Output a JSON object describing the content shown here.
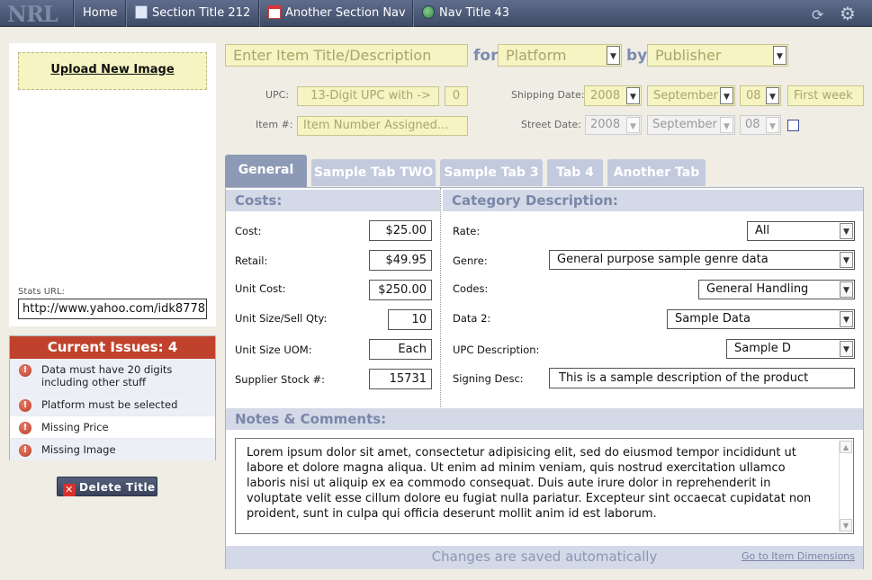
{
  "nav": {
    "logo": "NRL",
    "items": [
      {
        "label": "Home",
        "icon": "none"
      },
      {
        "label": "Section Title 212",
        "icon": "document-icon"
      },
      {
        "label": "Another Section Nav",
        "icon": "calendar-icon"
      },
      {
        "label": "Nav Title 43",
        "icon": "globe-icon"
      }
    ],
    "right_icons": [
      "refresh-icon",
      "gear-icon"
    ]
  },
  "left": {
    "upload_label": "Upload New Image",
    "stats_label": "Stats URL:",
    "stats_url": "http://www.yahoo.com/idk8778",
    "issues_title": "Current Issues: 4",
    "issues": [
      "Data must have 20 digits including other stuff",
      "Platform must be selected",
      "Missing Price",
      "Missing Image"
    ],
    "delete_label": "Delete Title"
  },
  "header": {
    "title_placeholder": "Enter Item Title/Description",
    "for_label": "for",
    "platform": "Platform",
    "by_label": "by",
    "publisher": "Publisher",
    "upc_label": "UPC:",
    "upc_placeholder": "13-Digit UPC with ->",
    "upc_check": "0",
    "item_label": "Item #:",
    "item_placeholder": "Item Number Assigned...",
    "shipping_label": "Shipping Date:",
    "ship_year": "2008",
    "ship_month": "September",
    "ship_day": "08",
    "ship_week": "First week",
    "street_label": "Street Date:",
    "street_year": "2008",
    "street_month": "September",
    "street_day": "08"
  },
  "tabs": [
    "General",
    "Sample Tab TWO",
    "Sample Tab 3",
    "Tab 4",
    "Another Tab"
  ],
  "costs": {
    "title": "Costs:",
    "rows": [
      {
        "label": "Cost:",
        "value": "$25.00"
      },
      {
        "label": "Retail:",
        "value": "$49.95"
      },
      {
        "label": "Unit Cost:",
        "value": "$250.00"
      },
      {
        "label": "Unit Size/Sell Qty:",
        "value": "10"
      },
      {
        "label": "Unit Size UOM:",
        "value": "Each"
      },
      {
        "label": "Supplier Stock #:",
        "value": "15731"
      }
    ]
  },
  "category": {
    "title": "Category Description:",
    "rows": [
      {
        "label": "Rate:",
        "value": "All"
      },
      {
        "label": "Genre:",
        "value": "General purpose sample genre data"
      },
      {
        "label": "Codes:",
        "value": "General Handling"
      },
      {
        "label": "Data 2:",
        "value": "Sample Data"
      },
      {
        "label": "UPC Description:",
        "value": "Sample D"
      },
      {
        "label": "Signing Desc:",
        "value": "This is a sample description of the product"
      }
    ]
  },
  "notes": {
    "title": "Notes & Comments:",
    "text": "Lorem ipsum dolor sit amet, consectetur adipisicing elit, sed do eiusmod tempor incididunt ut labore et dolore magna aliqua. Ut enim ad minim veniam, quis nostrud exercitation ullamco laboris nisi ut aliquip ex ea commodo consequat. Duis aute irure dolor in reprehenderit in voluptate velit esse cillum dolore eu fugiat nulla pariatur. Excepteur sint occaecat cupidatat non proident, sunt in culpa qui officia deserunt mollit anim id est laborum."
  },
  "footer": {
    "status": "Changes are saved automatically",
    "link": "Go to Item Dimensions"
  }
}
